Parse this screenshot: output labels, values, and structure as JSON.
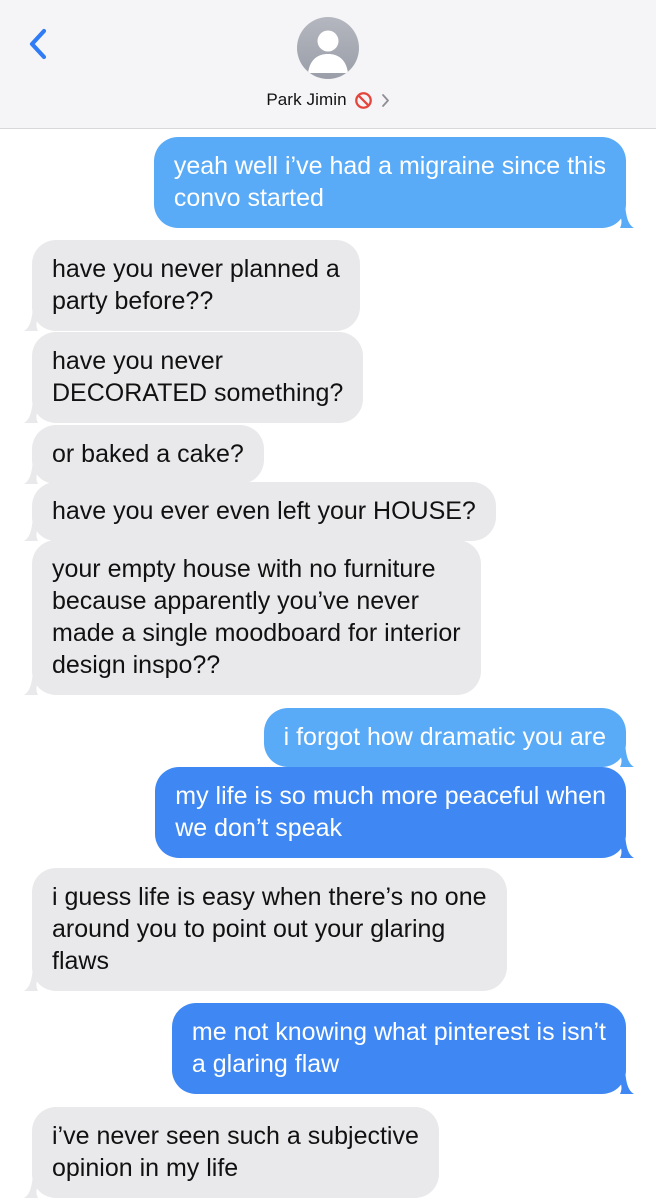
{
  "header": {
    "back_label": "",
    "contact_name": "Park Jimin",
    "status_icon": "blocked-icon",
    "disclosure_icon": "chevron-right-icon"
  },
  "colors": {
    "incoming_bubble": "#e9e9eb",
    "outgoing_bubble_light": "#5aabf7",
    "outgoing_bubble": "#3f88f3",
    "accent": "#2f7cf6",
    "blocked_red": "#e5463c"
  },
  "messages": [
    {
      "direction": "outgoing",
      "lines": [
        "yeah well i’ve had a migraine since this",
        "convo started"
      ]
    },
    {
      "direction": "incoming",
      "lines": [
        "have you never planned a",
        "party before??"
      ]
    },
    {
      "direction": "incoming",
      "lines": [
        "have you never",
        "DECORATED something?"
      ]
    },
    {
      "direction": "incoming",
      "lines": [
        "or baked a cake?"
      ]
    },
    {
      "direction": "incoming",
      "lines": [
        "have you ever even left your HOUSE?"
      ]
    },
    {
      "direction": "incoming",
      "lines": [
        "your empty house with no furniture",
        "because apparently you’ve never",
        "made a single moodboard for interior",
        "design inspo??"
      ]
    },
    {
      "direction": "outgoing",
      "lines": [
        "i forgot how dramatic you are"
      ]
    },
    {
      "direction": "outgoing",
      "lines": [
        "my life is so much more peaceful when",
        "we don’t speak"
      ]
    },
    {
      "direction": "incoming",
      "lines": [
        "i guess life is easy when there’s no one",
        "around you to point out your glaring",
        "flaws"
      ]
    },
    {
      "direction": "outgoing",
      "lines": [
        "me not knowing what pinterest is isn’t",
        "a glaring flaw"
      ]
    },
    {
      "direction": "incoming",
      "lines": [
        "i’ve never seen such a subjective",
        "opinion in my life"
      ]
    }
  ]
}
